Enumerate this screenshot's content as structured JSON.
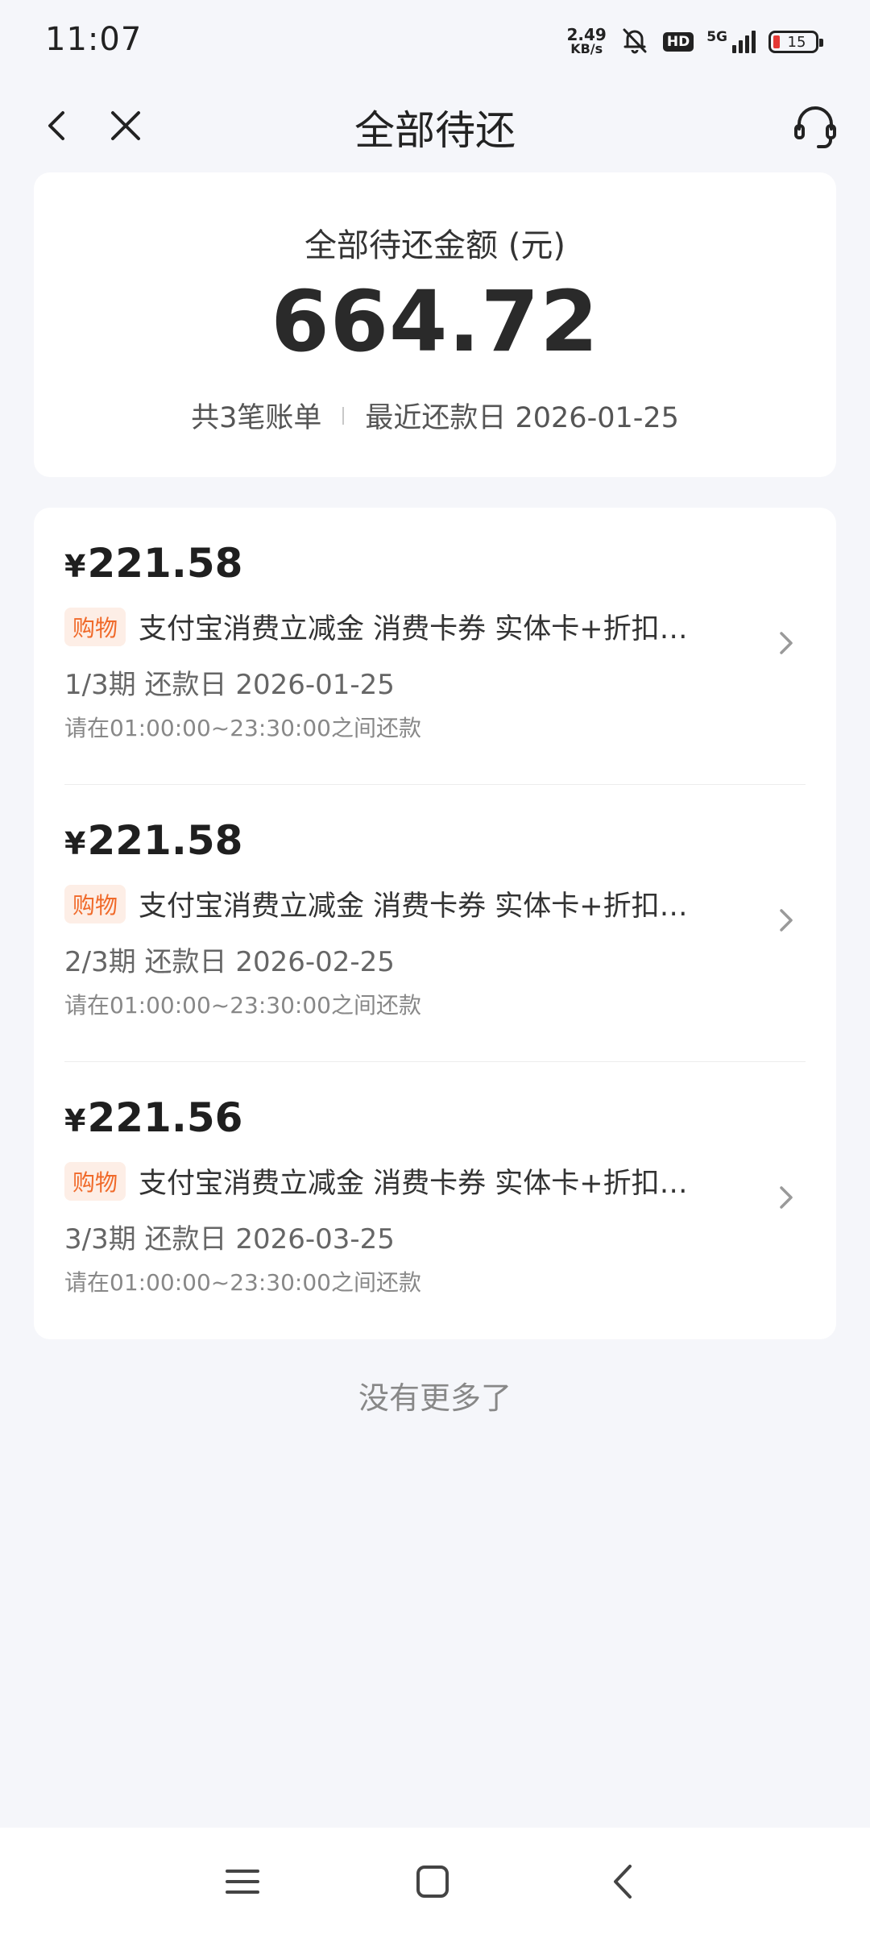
{
  "status_bar": {
    "time": "11:07",
    "net_speed_value": "2.49",
    "net_speed_unit": "KB/s",
    "hd_label": "HD",
    "network_label": "5G",
    "battery_level": "15",
    "battery_color": "#e53935"
  },
  "nav": {
    "title": "全部待还",
    "back_icon": "chevron-left-icon",
    "close_icon": "close-icon",
    "service_icon": "headset-icon"
  },
  "summary": {
    "label": "全部待还金额 (元)",
    "amount": "664.72",
    "bill_count": "共3笔账单",
    "recent_due": "最近还款日 2026-01-25"
  },
  "bills": [
    {
      "currency": "¥",
      "amount": "221.58",
      "tag": "购物",
      "description": "支付宝消费立减金 消费卡券 实体卡+折扣券...",
      "period": "1/3期  还款日 2026-01-25",
      "window": "请在01:00:00~23:30:00之间还款"
    },
    {
      "currency": "¥",
      "amount": "221.58",
      "tag": "购物",
      "description": "支付宝消费立减金 消费卡券 实体卡+折扣券...",
      "period": "2/3期  还款日 2026-02-25",
      "window": "请在01:00:00~23:30:00之间还款"
    },
    {
      "currency": "¥",
      "amount": "221.56",
      "tag": "购物",
      "description": "支付宝消费立减金 消费卡券 实体卡+折扣券...",
      "period": "3/3期  还款日 2026-03-25",
      "window": "请在01:00:00~23:30:00之间还款"
    }
  ],
  "footer": {
    "no_more": "没有更多了"
  },
  "colors": {
    "background": "#f5f6fa",
    "tag_text": "#f06a2a",
    "tag_background": "#fdeee6"
  }
}
